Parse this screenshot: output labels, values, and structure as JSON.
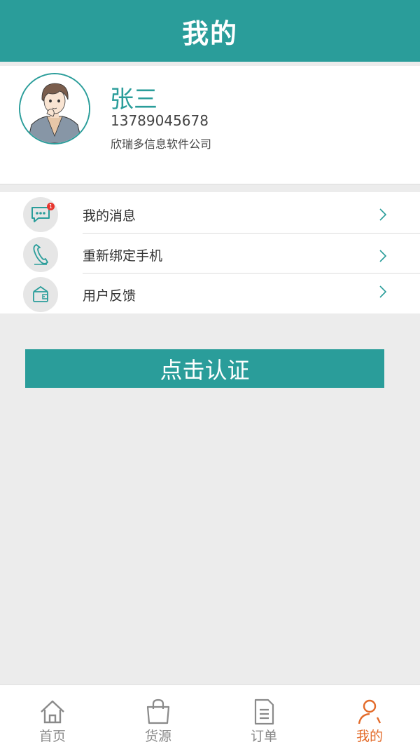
{
  "header": {
    "title": "我的"
  },
  "profile": {
    "name": "张三",
    "phone": "13789045678",
    "company": "欣瑞多信息软件公司"
  },
  "menu": {
    "items": [
      {
        "label": "我的消息",
        "icon": "message-icon",
        "badge": "1"
      },
      {
        "label": "重新绑定手机",
        "icon": "phone-icon"
      },
      {
        "label": "用户反馈",
        "icon": "feedback-icon"
      }
    ]
  },
  "auth_button": {
    "label": "点击认证"
  },
  "tabbar": {
    "active_color": "#e36b2a",
    "inactive_color": "#8a8a8a",
    "tabs": [
      {
        "label": "首页",
        "icon": "home-icon"
      },
      {
        "label": "货源",
        "icon": "bag-icon"
      },
      {
        "label": "订单",
        "icon": "document-icon"
      },
      {
        "label": "我的",
        "icon": "person-icon",
        "active": true
      }
    ]
  },
  "colors": {
    "brand": "#2a9d9a",
    "background": "#ececec",
    "badge": "#e8362f"
  }
}
